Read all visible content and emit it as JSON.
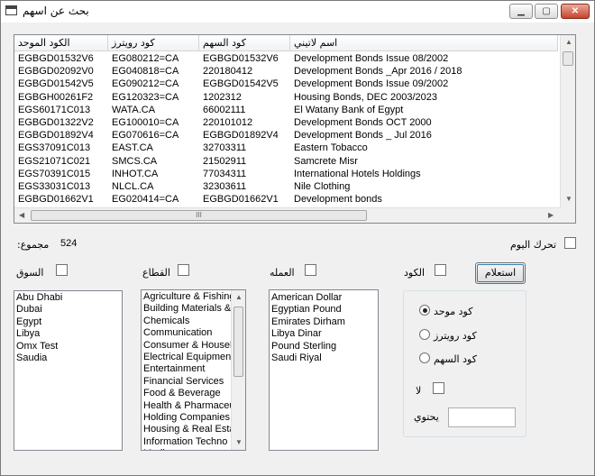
{
  "window": {
    "title": "بحث عن اسهم",
    "minimize_glyph": "▁",
    "maximize_glyph": "▢",
    "close_glyph": "✕"
  },
  "grid": {
    "headers": [
      "الكود الموحد",
      "كود رويترز",
      "كود السهم",
      "اسم لاتيني"
    ],
    "rows": [
      [
        "EGBGD01532V6",
        "EG080212=CA",
        "EGBGD01532V6",
        "Development Bonds Issue 08/2002"
      ],
      [
        "EGBGD02092V0",
        "EG040818=CA",
        "220180412",
        "Development Bonds _Apr 2016 / 2018"
      ],
      [
        "EGBGD01542V5",
        "EG090212=CA",
        "EGBGD01542V5",
        "Development Bonds Issue 09/2002"
      ],
      [
        "EGBGH00261F2",
        "EG120323=CA",
        "1202312",
        "Housing Bonds, DEC 2003/2023"
      ],
      [
        "EGS60171C013",
        "WATA.CA",
        "66002111",
        "El Watany Bank of Egypt"
      ],
      [
        "EGBGD01322V2",
        "EG100010=CA",
        "220101012",
        "Development Bonds OCT 2000"
      ],
      [
        "EGBGD01892V4",
        "EG070616=CA",
        "EGBGD01892V4",
        "Development Bonds _ Jul 2016"
      ],
      [
        "EGS37091C013",
        "EAST.CA",
        "32703311",
        "Eastern Tobacco"
      ],
      [
        "EGS21071C021",
        "SMCS.CA",
        "21502911",
        "Samcrete Misr"
      ],
      [
        "EGS70391C015",
        "INHOT.CA",
        "77034311",
        "International Hotels Holdings"
      ],
      [
        "EGS33031C013",
        "NLCL.CA",
        "32303611",
        "Nile Clothing"
      ],
      [
        "EGBGD01662V1",
        "EG020414=CA",
        "EGBGD01662V1",
        "Development bonds"
      ]
    ],
    "scroll_hint": "III"
  },
  "total": {
    "label": "مجموع:",
    "value": "524"
  },
  "today_move": {
    "label": "تحرك اليوم",
    "checked": false
  },
  "filters": {
    "market": {
      "label": "السوق",
      "checked": false
    },
    "sector": {
      "label": "القطاع",
      "checked": false
    },
    "currency": {
      "label": "العمله",
      "checked": false
    },
    "code": {
      "label": "الكود",
      "checked": false
    }
  },
  "query_button": "استعلام",
  "markets": [
    "Abu Dhabi",
    "Dubai",
    "Egypt",
    "Libya",
    "Omx Test",
    "Saudia"
  ],
  "sectors": [
    "Agriculture & Fishing",
    "Building Materials &",
    "Chemicals",
    "Communication",
    "Consumer & Househ",
    "Electrical Equipment",
    "Entertainment",
    "Financial Services",
    "Food & Beverage",
    "Health & Pharmaceu",
    "Holding Companies",
    "Housing & Real Esta",
    "Information Techno",
    "Media"
  ],
  "currencies": [
    "American Dollar",
    "Egyptian Pound",
    "Emirates Dirham",
    "Libya Dinar",
    "Pound Sterling",
    "Saudi Riyal"
  ],
  "code_type": {
    "options": [
      "كود موحد",
      "كود رويترز",
      "كود السهم"
    ],
    "selected": "كود موحد"
  },
  "not_option": {
    "label": "لا",
    "checked": false
  },
  "contains": {
    "label": "يحتوي",
    "value": ""
  }
}
